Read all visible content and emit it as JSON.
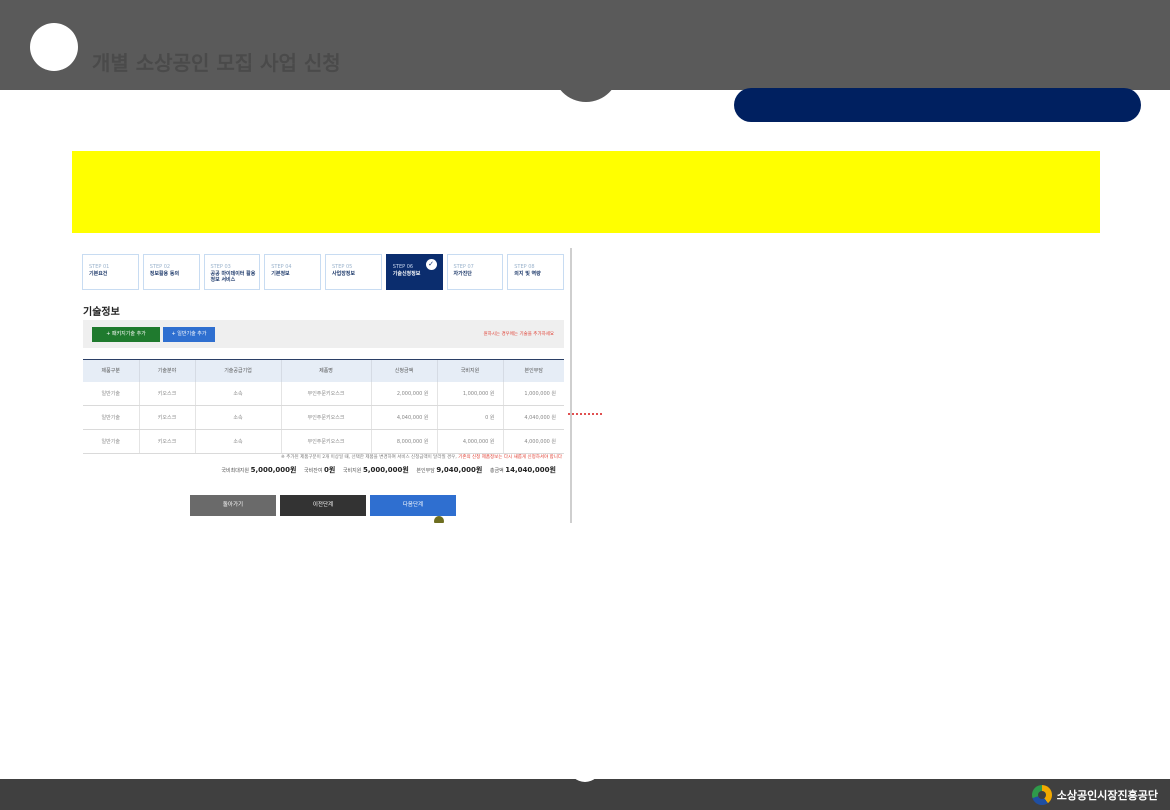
{
  "header": {
    "title": "개별 소상공인 모집 사업 신청"
  },
  "steps": [
    {
      "num": "STEP 01",
      "name": "기본요건"
    },
    {
      "num": "STEP 02",
      "name": "정보활용 동의"
    },
    {
      "num": "STEP 03",
      "name": "공공 마이데이터 활용정보 서비스"
    },
    {
      "num": "STEP 04",
      "name": "기본정보"
    },
    {
      "num": "STEP 05",
      "name": "사업장정보"
    },
    {
      "num": "STEP 06",
      "name": "기술신청정보"
    },
    {
      "num": "STEP 07",
      "name": "자가진단"
    },
    {
      "num": "STEP 08",
      "name": "의지 및 역량"
    }
  ],
  "section": {
    "title": "기술정보",
    "btn_green": "+ 패키지기술 추가",
    "btn_blue": "+ 일반기술 추가",
    "notice": "원하시는 경우에는 기술을 추가하세요"
  },
  "table": {
    "headers": [
      "제품구분",
      "기술분야",
      "기술공급기업",
      "제품명",
      "신청금액",
      "국비지원",
      "본인부담"
    ],
    "rows": [
      [
        "일반기술",
        "키오스크",
        "소속",
        "무인주문키오스크",
        "2,000,000 원",
        "1,000,000 원",
        "1,000,000 원"
      ],
      [
        "일반기술",
        "키오스크",
        "소속",
        "무인주문키오스크",
        "4,040,000 원",
        "0 원",
        "4,040,000 원"
      ],
      [
        "일반기술",
        "키오스크",
        "소속",
        "무인주문키오스크",
        "8,000,000 원",
        "4,000,000 원",
        "4,000,000 원"
      ]
    ]
  },
  "note": {
    "text": "※ 추가된 제품구분이 2개 이상일 때, 선택한 제품을 변경하여 서비스 신청금액이 달라질 경우,",
    "highlight": "기존의 신청 제품정보는 다시 새롭게 신청하셔야 합니다"
  },
  "totals": {
    "gov_label": "국비최대지원",
    "gov_value": "5,000,000원",
    "remain_label": "국비잔여",
    "remain_value": "0원",
    "support_label": "국비지원",
    "support_value": "5,000,000원",
    "self_label": "본인부담",
    "self_value": "9,040,000원",
    "total_label": "총금액",
    "total_value": "14,040,000원"
  },
  "buttons": {
    "back": "돌아가기",
    "prev": "이전단계",
    "next": "다음단계"
  },
  "footer": {
    "org": "소상공인시장진흥공단"
  },
  "colors": {
    "header_bg": "#5a5a5a",
    "navy": "#002060",
    "banner": "#ffff00",
    "active_step": "#0b2d6e",
    "primary_blue": "#2f6fd0",
    "green": "#1f7a2e"
  }
}
